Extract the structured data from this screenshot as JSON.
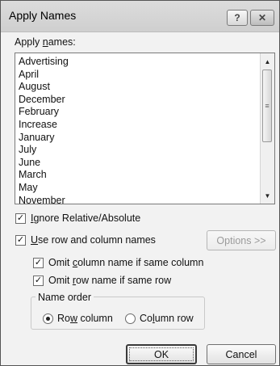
{
  "dialog": {
    "title": "Apply Names",
    "help_button": "?",
    "close_button": "✕"
  },
  "apply_names": {
    "label_prefix": "Apply ",
    "label_mnemonic": "n",
    "label_suffix": "ames:",
    "items": [
      "Advertising",
      "April",
      "August",
      "December",
      "February",
      "Increase",
      "January",
      "July",
      "June",
      "March",
      "May",
      "November"
    ]
  },
  "ignore_relative": {
    "checked": true,
    "mnemonic": "I",
    "rest": "gnore Relative/Absolute"
  },
  "use_row_column": {
    "checked": true,
    "mnemonic": "U",
    "rest": "se row and column names"
  },
  "options_button": "Options >>",
  "omit_column": {
    "checked": true,
    "before": "Omit ",
    "mnemonic": "c",
    "after": "olumn name if same column"
  },
  "omit_row": {
    "checked": true,
    "before": "Omit ",
    "mnemonic": "r",
    "after": "ow name if same row"
  },
  "name_order": {
    "title": "Name order",
    "row_column": {
      "selected": true,
      "before": "Ro",
      "mnemonic": "w",
      "after": " column"
    },
    "column_row": {
      "selected": false,
      "before": "Co",
      "mnemonic": "l",
      "after": "umn row"
    }
  },
  "ok_button": "OK",
  "cancel_button": "Cancel"
}
